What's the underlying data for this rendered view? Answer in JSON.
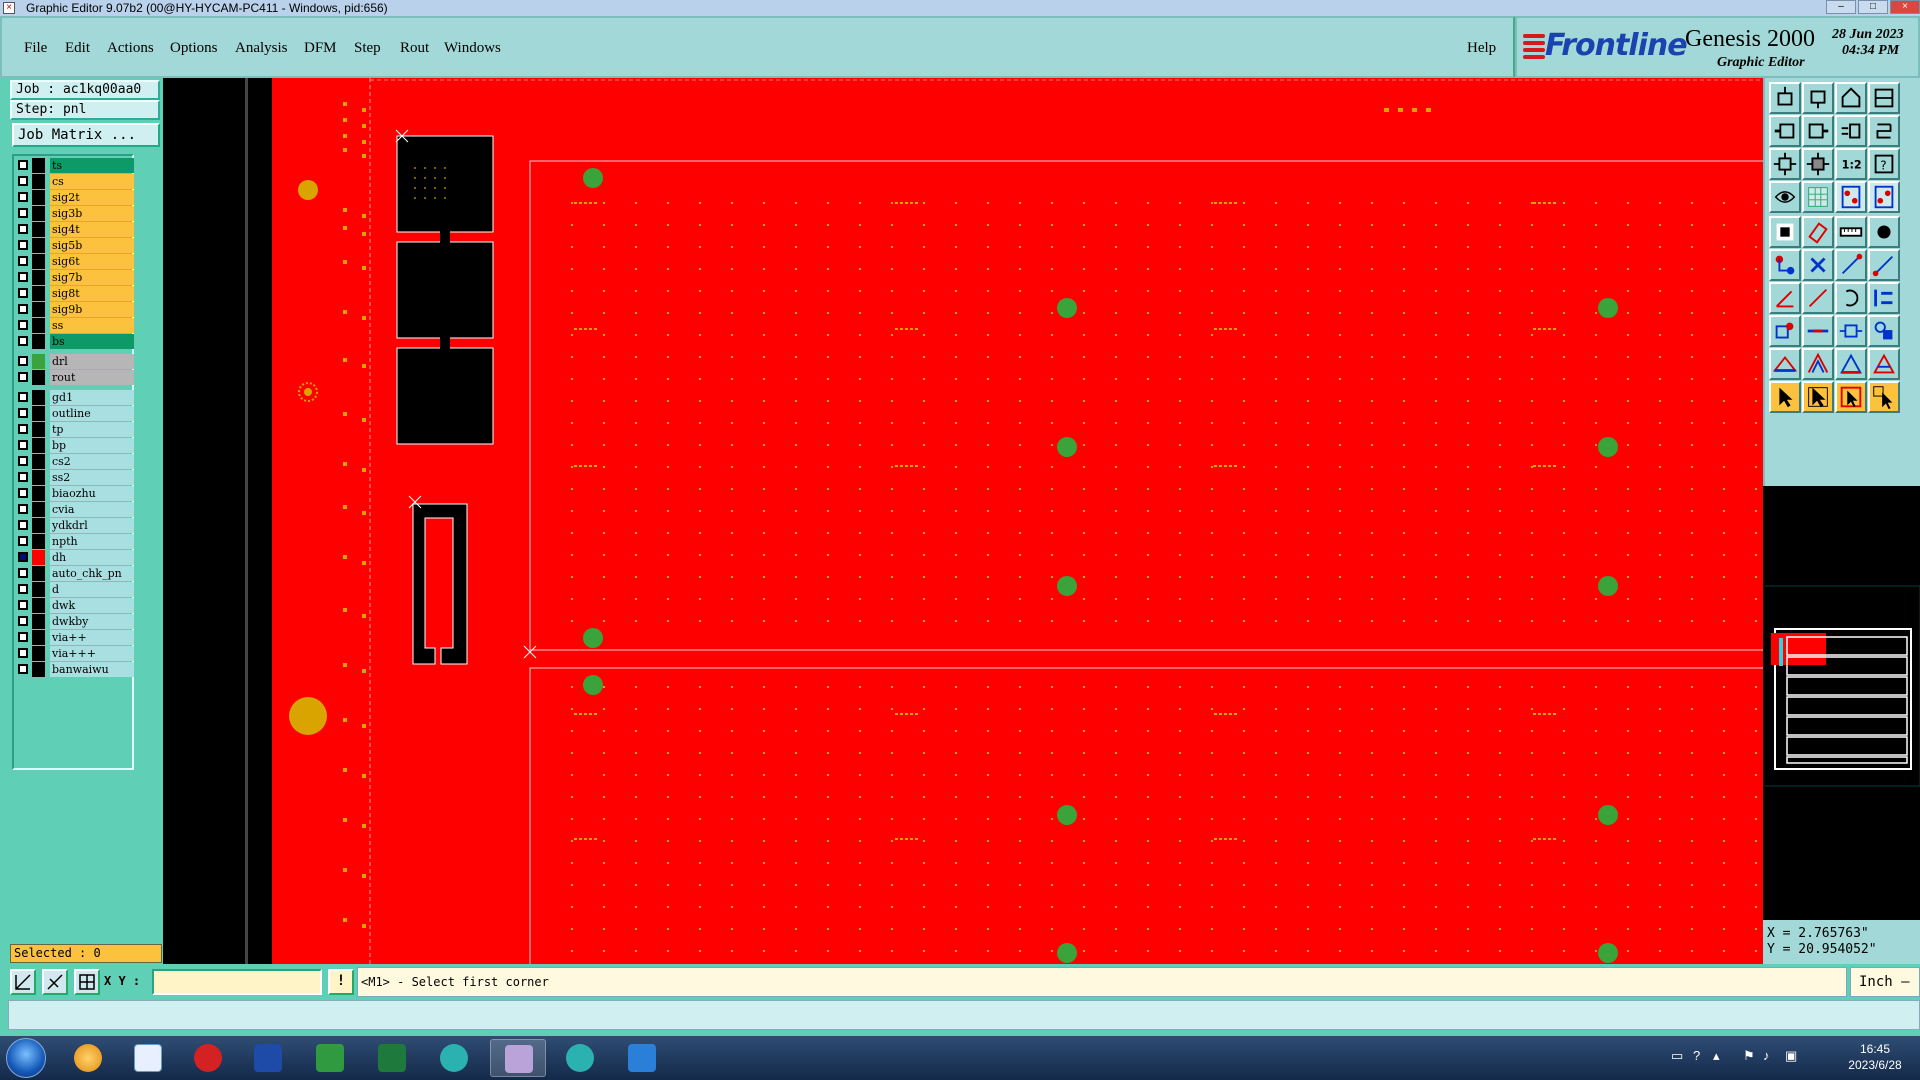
{
  "window": {
    "title": "Graphic Editor 9.07b2 (00@HY-HYCAM-PC411 - Windows, pid:656)"
  },
  "menu": {
    "items": [
      "File",
      "Edit",
      "Actions",
      "Options",
      "Analysis",
      "DFM",
      "Step",
      "Rout",
      "Windows"
    ],
    "help": "Help"
  },
  "brand": {
    "logo_text": "Frontline",
    "product": "Genesis 2000",
    "subtitle": "Graphic Editor",
    "date": "28 Jun 2023",
    "time": "04:34 PM",
    "logo_color": "#1a43b0",
    "accent_color": "#d6191b"
  },
  "job": {
    "job_label": "Job : ac1kq00aa0",
    "step_label": "Step: pnl",
    "matrix_button": "Job Matrix ..."
  },
  "layers": [
    {
      "name": "ts",
      "type": "mask",
      "swatch": "#000000",
      "active": false
    },
    {
      "name": "cs",
      "type": "sig",
      "swatch": "#000000",
      "active": false
    },
    {
      "name": "sig2t",
      "type": "sig",
      "swatch": "#000000",
      "active": false
    },
    {
      "name": "sig3b",
      "type": "sig",
      "swatch": "#000000",
      "active": false
    },
    {
      "name": "sig4t",
      "type": "sig",
      "swatch": "#000000",
      "active": false
    },
    {
      "name": "sig5b",
      "type": "sig",
      "swatch": "#000000",
      "active": false
    },
    {
      "name": "sig6t",
      "type": "sig",
      "swatch": "#000000",
      "active": false
    },
    {
      "name": "sig7b",
      "type": "sig",
      "swatch": "#000000",
      "active": false
    },
    {
      "name": "sig8t",
      "type": "sig",
      "swatch": "#000000",
      "active": false
    },
    {
      "name": "sig9b",
      "type": "sig",
      "swatch": "#000000",
      "active": false
    },
    {
      "name": "ss",
      "type": "sig",
      "swatch": "#000000",
      "active": false
    },
    {
      "name": "bs",
      "type": "mask",
      "swatch": "#000000",
      "active": false
    },
    {
      "name": "drl",
      "type": "drill",
      "swatch": "#3aa33a",
      "active": false
    },
    {
      "name": "rout",
      "type": "drill",
      "swatch": "#000000",
      "active": false
    },
    {
      "name": "gd1",
      "type": "misc",
      "swatch": "#000000",
      "active": false
    },
    {
      "name": "outline",
      "type": "misc",
      "swatch": "#000000",
      "active": false
    },
    {
      "name": "tp",
      "type": "misc",
      "swatch": "#000000",
      "active": false
    },
    {
      "name": "bp",
      "type": "misc",
      "swatch": "#000000",
      "active": false
    },
    {
      "name": "cs2",
      "type": "misc",
      "swatch": "#000000",
      "active": false
    },
    {
      "name": "ss2",
      "type": "misc",
      "swatch": "#000000",
      "active": false
    },
    {
      "name": "biaozhu",
      "type": "misc",
      "swatch": "#000000",
      "active": false
    },
    {
      "name": "cvia",
      "type": "misc",
      "swatch": "#000000",
      "active": false
    },
    {
      "name": "ydkdrl",
      "type": "misc",
      "swatch": "#000000",
      "active": false
    },
    {
      "name": "npth",
      "type": "misc",
      "swatch": "#000000",
      "active": false
    },
    {
      "name": "dh",
      "type": "misc",
      "swatch": "#ff0000",
      "active": true
    },
    {
      "name": "auto_chk_pn",
      "type": "misc",
      "swatch": "#000000",
      "active": false
    },
    {
      "name": "d",
      "type": "misc",
      "swatch": "#000000",
      "active": false
    },
    {
      "name": "dwk",
      "type": "misc",
      "swatch": "#000000",
      "active": false
    },
    {
      "name": "dwkby",
      "type": "misc",
      "swatch": "#000000",
      "active": false
    },
    {
      "name": "via++",
      "type": "misc",
      "swatch": "#000000",
      "active": false
    },
    {
      "name": "via+++",
      "type": "misc",
      "swatch": "#000000",
      "active": false
    },
    {
      "name": "banwaiwu",
      "type": "misc",
      "swatch": "#000000",
      "active": false
    }
  ],
  "status": {
    "selected": "Selected : 0"
  },
  "coordinates": {
    "x": "X = 2.765763\"",
    "y": "Y = 20.954052\""
  },
  "command": {
    "xy_label": "X Y :",
    "xy_value": "",
    "warn_label": "!",
    "prompt": "<M1> - Select first corner",
    "unit": "Inch"
  },
  "colors": {
    "board_fill": "#ff0000",
    "pad_green": "#3aa33a",
    "feature_yellow": "#d9a400",
    "panel_bg": "#5fcfb5"
  },
  "tools": [
    "zoom-home-icon",
    "zoom-in-icon",
    "home-icon",
    "window-icon",
    "pan-left-icon",
    "pan-right-icon",
    "mirror-icon",
    "snap-icon",
    "fit-icon",
    "fit-all-icon",
    "ratio-icon",
    "help-icon",
    "grid-icon",
    "display-icon",
    "layers-icon",
    "layers-alt-icon",
    "select-icon",
    "erase-icon",
    "measure-icon",
    "circle-icon",
    "connect-icon",
    "cross-icon",
    "line-icon",
    "line-alt-icon",
    "angle-icon",
    "slash-icon",
    "rotate-icon",
    "align-icon",
    "pad-icon",
    "trace-icon",
    "resize-icon",
    "group-icon",
    "triangle-icon",
    "triangle-alt-icon",
    "triangle-b-icon",
    "triangle-c-icon",
    "pointer-icon",
    "pointer-alt-icon",
    "pointer-box-icon",
    "pointer-group-icon"
  ],
  "clock": {
    "time": "16:45",
    "date": "2023/6/28"
  }
}
